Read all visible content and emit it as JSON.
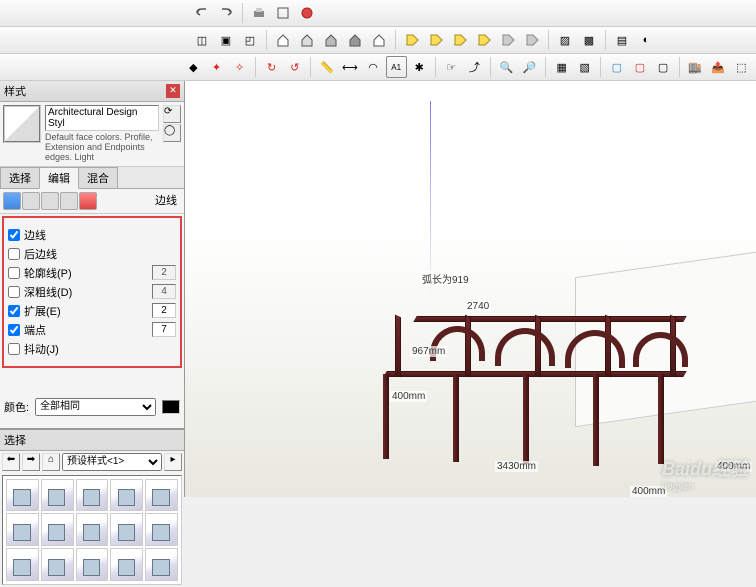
{
  "panel": {
    "title": "样式",
    "style_name": "Architectural Design Styl",
    "style_desc": "Default face colors. Profile, Extension and Endpoints edges. Light"
  },
  "tabs": {
    "select": "选择",
    "edit": "编辑",
    "mix": "混合"
  },
  "edge_section": {
    "label": "边线",
    "edges": "边线",
    "back_edges": "后边线",
    "profiles": "轮廓线(P)",
    "profiles_val": "2",
    "depth": "深粗线(D)",
    "depth_val": "4",
    "extension": "扩展(E)",
    "extension_val": "2",
    "endpoints": "端点",
    "endpoints_val": "7",
    "jitter": "抖动(J)"
  },
  "color": {
    "label": "颜色:",
    "mode": "全部相同"
  },
  "selector": {
    "title": "选择",
    "preset": "预设样式<1>"
  },
  "viewport": {
    "arc_label": "弧长为919",
    "dim_2740": "2740",
    "dim_967": "967mm",
    "dim_400_1": "400mm",
    "dim_3430": "3430mm",
    "dim_400_2": "400mm",
    "dim_400_3": "400mm"
  },
  "watermark": {
    "main": "Baidu经验",
    "sub": "jingyan"
  }
}
